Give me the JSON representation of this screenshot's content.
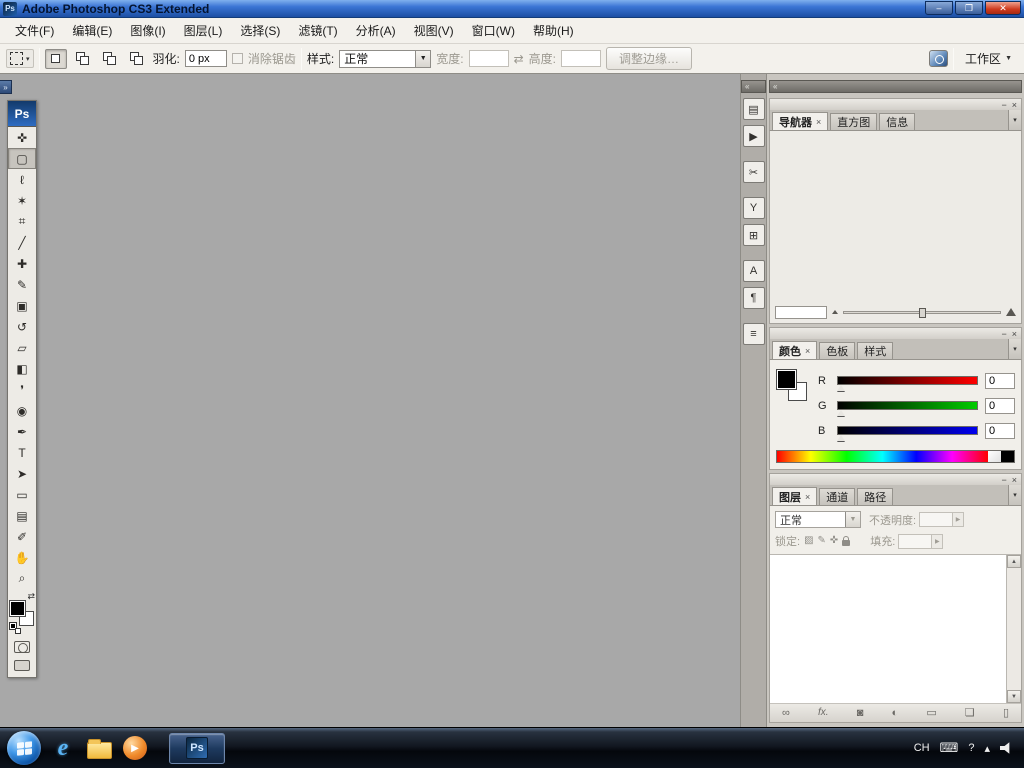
{
  "ui": {
    "tab_close": "×",
    "panel_min": "−",
    "panel_close": "×",
    "panel_menu": "▾",
    "collapse_left": "«",
    "collapse_right": "»",
    "scroll_up": "▲",
    "scroll_down": "▼",
    "swap": "⇄",
    "dropdown": "▼",
    "spinner": "▶",
    "min": "–",
    "max": "❐",
    "close": "✕",
    "help": "?",
    "up_arrow": "▴"
  },
  "window": {
    "title": "Adobe Photoshop CS3 Extended",
    "logo": "Ps"
  },
  "menu": {
    "items": [
      "文件(F)",
      "编辑(E)",
      "图像(I)",
      "图层(L)",
      "选择(S)",
      "滤镜(T)",
      "分析(A)",
      "视图(V)",
      "窗口(W)",
      "帮助(H)"
    ]
  },
  "options": {
    "feather_label": "羽化:",
    "feather_value": "0 px",
    "antialias_label": "消除锯齿",
    "style_label": "样式:",
    "style_value": "正常",
    "width_label": "宽度:",
    "width_value": "",
    "height_label": "高度:",
    "height_value": "",
    "refine_edge_label": "调整边缘…",
    "workspace_label": "工作区"
  },
  "toolbox": {
    "logo": "Ps",
    "tools": [
      {
        "name": "move",
        "glyph": "✜"
      },
      {
        "name": "rectangular-marquee",
        "glyph": "▢"
      },
      {
        "name": "lasso",
        "glyph": "ℓ"
      },
      {
        "name": "quick-selection",
        "glyph": "✶"
      },
      {
        "name": "crop",
        "glyph": "⌗"
      },
      {
        "name": "slice",
        "glyph": "╱"
      },
      {
        "name": "healing-brush",
        "glyph": "✚"
      },
      {
        "name": "brush",
        "glyph": "✎"
      },
      {
        "name": "clone-stamp",
        "glyph": "▣"
      },
      {
        "name": "history-brush",
        "glyph": "↺"
      },
      {
        "name": "eraser",
        "glyph": "▱"
      },
      {
        "name": "gradient",
        "glyph": "◧"
      },
      {
        "name": "blur",
        "glyph": "❜"
      },
      {
        "name": "dodge",
        "glyph": "◉"
      },
      {
        "name": "pen",
        "glyph": "✒"
      },
      {
        "name": "type",
        "glyph": "T"
      },
      {
        "name": "path-selection",
        "glyph": "➤"
      },
      {
        "name": "shape",
        "glyph": "▭"
      },
      {
        "name": "notes",
        "glyph": "▤"
      },
      {
        "name": "eyedropper",
        "glyph": "✐"
      },
      {
        "name": "hand",
        "glyph": "✋"
      },
      {
        "name": "zoom",
        "glyph": "⌕"
      }
    ]
  },
  "collapsed_dock": {
    "icons": [
      {
        "name": "history",
        "glyph": "▤"
      },
      {
        "name": "actions",
        "glyph": "▶"
      },
      {
        "name": "tool-presets",
        "glyph": "✂"
      },
      {
        "name": "brushes",
        "glyph": "Y"
      },
      {
        "name": "clone-source",
        "glyph": "⊞"
      },
      {
        "name": "character",
        "glyph": "A"
      },
      {
        "name": "paragraph",
        "glyph": "¶"
      },
      {
        "name": "layer-comps",
        "glyph": "≡"
      }
    ]
  },
  "navigator": {
    "tabs": [
      "导航器",
      "直方图",
      "信息"
    ],
    "zoom_value": ""
  },
  "color": {
    "tabs": [
      "颜色",
      "色板",
      "样式"
    ],
    "channels": [
      {
        "label": "R",
        "value": "0"
      },
      {
        "label": "G",
        "value": "0"
      },
      {
        "label": "B",
        "value": "0"
      }
    ]
  },
  "layers": {
    "tabs": [
      "图层",
      "通道",
      "路径"
    ],
    "blend_mode": "正常",
    "opacity_label": "不透明度:",
    "lock_label": "锁定:",
    "fill_label": "填充:",
    "buttons": [
      {
        "name": "link-layers",
        "glyph": "∞"
      },
      {
        "name": "layer-style",
        "glyph": "fx."
      },
      {
        "name": "layer-mask",
        "glyph": "◙"
      },
      {
        "name": "adjustment-layer",
        "glyph": "◐"
      },
      {
        "name": "layer-group",
        "glyph": "▭"
      },
      {
        "name": "new-layer",
        "glyph": "❏"
      },
      {
        "name": "delete-layer",
        "glyph": "▯"
      }
    ]
  },
  "taskbar": {
    "lang": "CH",
    "ps_logo": "Ps"
  }
}
